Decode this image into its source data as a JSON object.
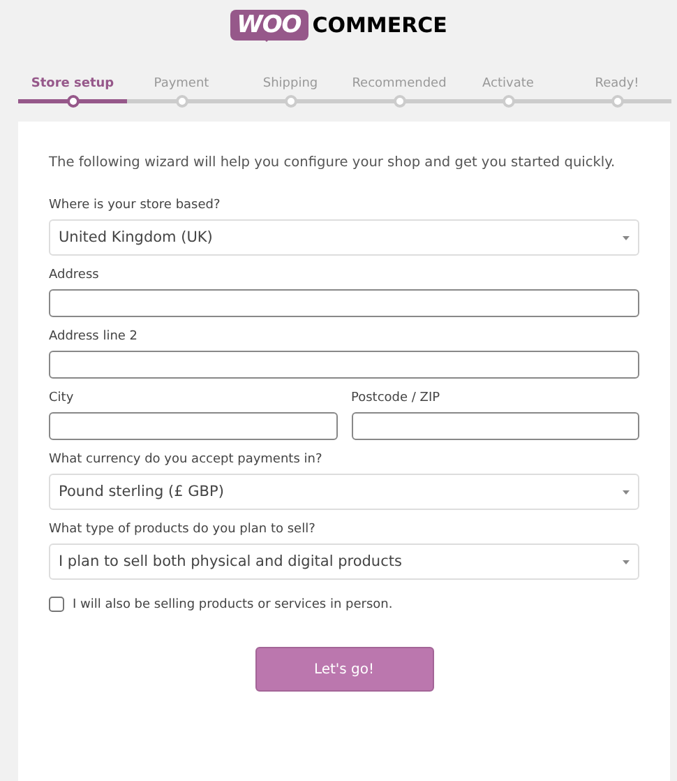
{
  "logo": {
    "badge": "WOO",
    "word": "COMMERCE"
  },
  "steps": [
    {
      "label": "Store setup",
      "selected": true,
      "done": true
    },
    {
      "label": "Payment",
      "selected": false,
      "done": false
    },
    {
      "label": "Shipping",
      "selected": false,
      "done": false
    },
    {
      "label": "Recommended",
      "selected": false,
      "done": false
    },
    {
      "label": "Activate",
      "selected": false,
      "done": false
    },
    {
      "label": "Ready!",
      "selected": false,
      "done": false
    }
  ],
  "intro": "The following wizard will help you configure your shop and get you started quickly.",
  "rows": [
    [
      {
        "kind": "select",
        "label": "Where is your store based?",
        "value": "United Kingdom (UK)"
      }
    ],
    [
      {
        "kind": "text",
        "label": "Address"
      }
    ],
    [
      {
        "kind": "text",
        "label": "Address line 2"
      }
    ],
    [
      {
        "kind": "text",
        "label": "City"
      },
      {
        "kind": "text",
        "label": "Postcode / ZIP"
      }
    ],
    [
      {
        "kind": "select",
        "label": "What currency do you accept payments in?",
        "value": "Pound sterling (£ GBP)"
      }
    ],
    [
      {
        "kind": "select",
        "label": "What type of products do you plan to sell?",
        "value": "I plan to sell both physical and digital products"
      }
    ]
  ],
  "in_person": {
    "label": "I will also be selling products or services in person.",
    "checked": false
  },
  "submit": "Let's go!"
}
